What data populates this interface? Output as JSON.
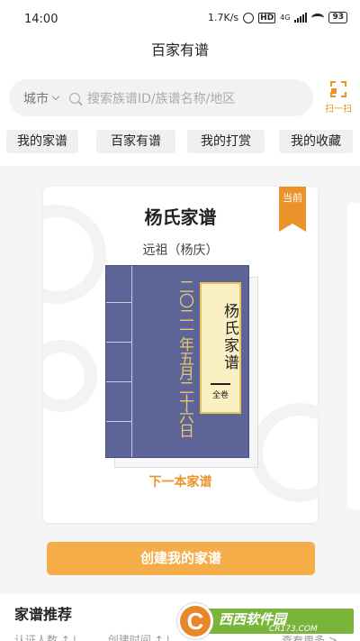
{
  "status": {
    "time": "14:00",
    "speed": "1.7K/s",
    "hd": "HD",
    "network": "4G",
    "battery": "93"
  },
  "app": {
    "title": "百家有谱"
  },
  "search": {
    "city": "城市",
    "placeholder": "搜索族谱ID/族谱名称/地区",
    "scan_label": "扫一扫"
  },
  "tabs": [
    {
      "label": "我的家谱"
    },
    {
      "label": "百家有谱"
    },
    {
      "label": "我的打赏"
    },
    {
      "label": "我的收藏"
    }
  ],
  "card": {
    "title": "杨氏家谱",
    "tag": "当前",
    "ancestor": "远祖（杨庆）",
    "book_name": "杨氏家谱",
    "book_volume": "全卷",
    "book_date": "二〇二一年五月二十六日",
    "next_label": "下一本家谱"
  },
  "create_button": "创建我的家谱",
  "recommend": {
    "title": "家谱推荐",
    "columns": [
      "认证人数 ↑↓",
      "创建时间 ↑↓"
    ],
    "view_more": "查看更多 >"
  },
  "watermark": {
    "logo_letter": "C",
    "text": "西西软件园",
    "url": "CR173.COM"
  },
  "colors": {
    "accent": "#e9932a",
    "button": "#f4ad48",
    "book_cover": "#5d6497",
    "label_paper": "#faf0c3"
  }
}
